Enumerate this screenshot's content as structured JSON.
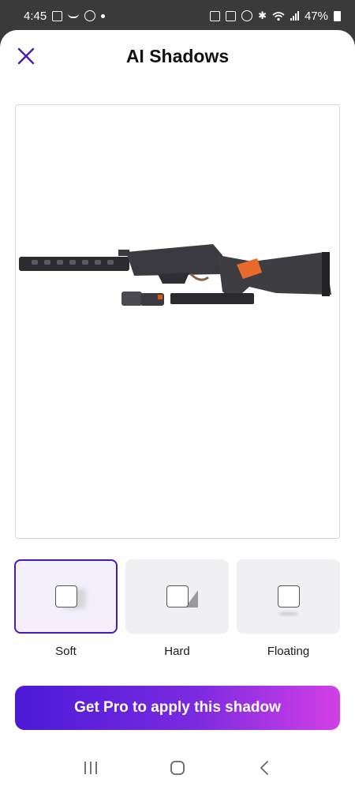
{
  "status_bar": {
    "time": "4:45",
    "battery": "47%",
    "left_icons": [
      "image-icon",
      "amazon-smile-icon",
      "whatsapp-icon",
      "dot-icon"
    ],
    "right_icons": [
      "notification-icon",
      "app-icon",
      "alarm-icon",
      "bluetooth-icon",
      "wifi-icon",
      "signal-icon",
      "battery-icon"
    ]
  },
  "header": {
    "title": "AI Shadows",
    "close_icon": "close-icon"
  },
  "shadow_options": [
    {
      "label": "Soft",
      "selected": true,
      "icon": "soft-shadow-icon"
    },
    {
      "label": "Hard",
      "selected": false,
      "icon": "hard-shadow-icon"
    },
    {
      "label": "Floating",
      "selected": false,
      "icon": "floating-shadow-icon"
    }
  ],
  "cta": {
    "label": "Get Pro to apply this shadow"
  },
  "nav_bar": {
    "icons": [
      "recent-apps-icon",
      "home-icon",
      "back-icon"
    ]
  },
  "colors": {
    "accent": "#4b1ab4",
    "cta_gradient_start": "#4a1ad8",
    "cta_gradient_end": "#d43fe6",
    "status_bar_bg": "#3a3a3a"
  }
}
